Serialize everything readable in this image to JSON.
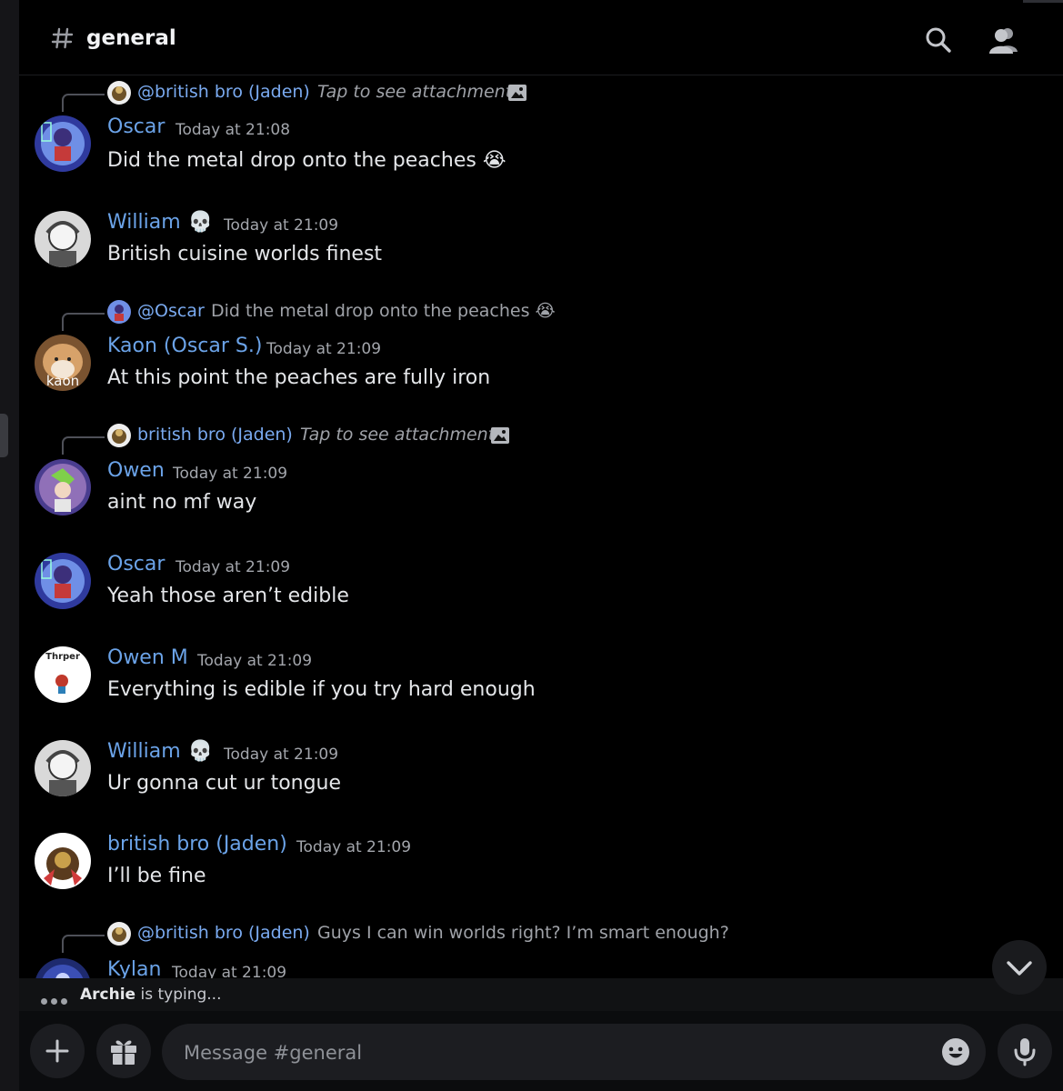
{
  "header": {
    "channel_name": "general"
  },
  "messages": [
    {
      "reply": {
        "name": "@british bro (Jaden)",
        "content": "Tap to see attachment",
        "attachment": true
      },
      "author": "Oscar",
      "time": "Today at 21:08",
      "text": "Did the metal drop onto the peaches",
      "emoji": "😭"
    },
    {
      "author": "William",
      "author_emoji": "💀",
      "time": "Today at 21:09",
      "text": "British cuisine worlds finest"
    },
    {
      "reply": {
        "name": "@Oscar",
        "content": "Did the metal drop onto the peaches 😭"
      },
      "author": "Kaon (Oscar S.)",
      "avatar_label": "kaon",
      "time": "Today at 21:09",
      "text": "At this point the peaches are fully iron"
    },
    {
      "reply": {
        "name": "british bro (Jaden)",
        "content": "Tap to see attachment",
        "attachment": true
      },
      "author": "Owen",
      "time": "Today at 21:09",
      "text": "aint no mf way"
    },
    {
      "author": "Oscar",
      "time": "Today at 21:09",
      "text": "Yeah those aren’t edible"
    },
    {
      "author": "Owen M",
      "avatar_label": "Thrper",
      "time": "Today at 21:09",
      "text": "Everything is edible if you try hard enough"
    },
    {
      "author": "William",
      "author_emoji": "💀",
      "time": "Today at 21:09",
      "text": "Ur gonna cut ur tongue"
    },
    {
      "author": "british bro (Jaden)",
      "time": "Today at 21:09",
      "text": "I’ll be fine"
    },
    {
      "reply": {
        "name": "@british bro (Jaden)",
        "content": "Guys I can win worlds right? I’m smart enough?"
      },
      "author": "Kylan",
      "time": "Today at 21:09"
    }
  ],
  "typing": {
    "user": "Archie",
    "suffix": " is typing..."
  },
  "composer": {
    "placeholder": "Message #general"
  },
  "icons": {
    "channel": "hash-icon",
    "search": "search-icon",
    "members": "members-icon",
    "attachment": "image-icon",
    "add": "plus-icon",
    "gift": "gift-icon",
    "emoji": "emoji-icon",
    "voice": "microphone-icon",
    "scroll": "chevron-down-icon"
  },
  "colors": {
    "background": "#000000",
    "username": "#6ba3e8",
    "muted": "#a3a6ac"
  }
}
